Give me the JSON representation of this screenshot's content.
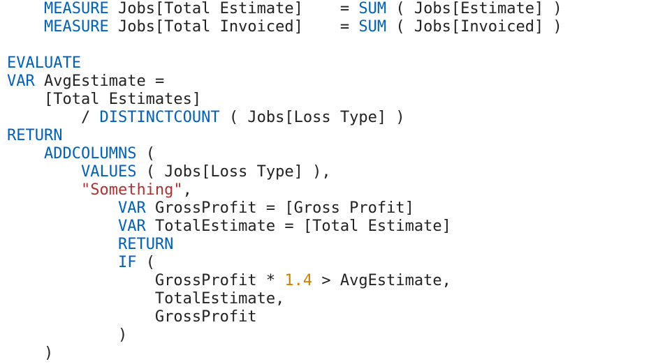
{
  "code": {
    "l1": {
      "kw_measure": "MEASURE",
      "lhs": "Jobs[Total Estimate]",
      "eq": "=",
      "fn_sum": "SUM",
      "paren_open": "(",
      "arg": "Jobs[Estimate]",
      "paren_close": ")"
    },
    "l2": {
      "kw_measure": "MEASURE",
      "lhs": "Jobs[Total Invoiced]",
      "eq": "=",
      "fn_sum": "SUM",
      "paren_open": "(",
      "arg": "Jobs[Invoiced]",
      "paren_close": ")"
    },
    "l3": {
      "blank": ""
    },
    "l4": {
      "kw_evaluate": "EVALUATE"
    },
    "l5": {
      "kw_var": "VAR",
      "name": "AvgEstimate",
      "eq": "="
    },
    "l6": {
      "expr": "[Total Estimates]"
    },
    "l7": {
      "slash": "/",
      "fn_dc": "DISTINCTCOUNT",
      "paren_open": "(",
      "arg": "Jobs[Loss Type]",
      "paren_close": ")"
    },
    "l8": {
      "kw_return": "RETURN"
    },
    "l9": {
      "fn_addcol": "ADDCOLUMNS",
      "paren_open": "("
    },
    "l10": {
      "fn_values": "VALUES",
      "paren_open": "(",
      "arg": "Jobs[Loss Type]",
      "paren_close": "),",
      "comma_only": ","
    },
    "l11": {
      "str": "\"Something\"",
      "comma": ","
    },
    "l12": {
      "kw_var": "VAR",
      "name": "GrossProfit",
      "eq": "=",
      "rhs": "[Gross Profit]"
    },
    "l13": {
      "kw_var": "VAR",
      "name": "TotalEstimate",
      "eq": "=",
      "rhs": "[Total Estimate]"
    },
    "l14": {
      "kw_return": "RETURN"
    },
    "l15": {
      "fn_if": "IF",
      "paren_open": "("
    },
    "l16": {
      "lhs": "GrossProfit",
      "star": "*",
      "num": "1.4",
      "gt": ">",
      "rhs": "AvgEstimate,",
      "rhs_nocomma": "AvgEstimate",
      "comma": ","
    },
    "l17": {
      "expr": "TotalEstimate,",
      "expr_nocomma": "TotalEstimate",
      "comma": ","
    },
    "l18": {
      "expr": "GrossProfit"
    },
    "l19": {
      "paren_close": ")"
    },
    "l20": {
      "paren_close": ")"
    }
  }
}
